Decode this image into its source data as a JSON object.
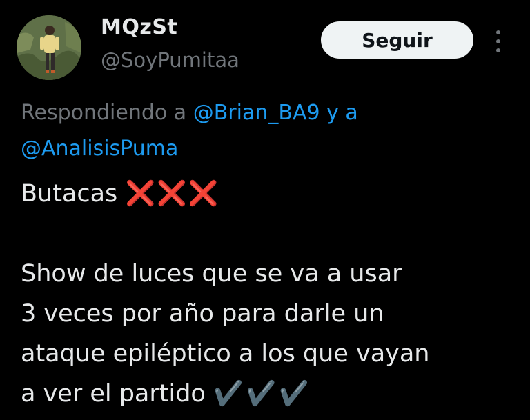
{
  "tweet": {
    "author": {
      "display_name": "MQzSt",
      "handle": "@SoyPumitaa"
    },
    "follow_label": "Seguir",
    "reply_prefix": "Respondiendo a",
    "reply_mention_1": "@Brian_BA9",
    "reply_joiner": "y a",
    "reply_mention_2": "@AnalisisPuma",
    "text_line_1": "Butacas",
    "text_line_1_emoji": "❌❌❌",
    "text_line_2": "Show de luces que se va a usar",
    "text_line_3": "3 veces por año para darle un",
    "text_line_4": "ataque epiléptico a los que vayan",
    "text_line_5": "a ver el partido",
    "text_line_5_emoji": "✔️✔️✔️"
  },
  "icons": {
    "avatar": "profile-photo",
    "more": "more-vertical-icon"
  },
  "colors": {
    "background": "#000000",
    "text_primary": "#e7e9ea",
    "text_secondary": "#71767b",
    "link": "#1d9bf0",
    "follow_button_bg": "#eff3f4",
    "cross_mark": "#e0242e"
  }
}
